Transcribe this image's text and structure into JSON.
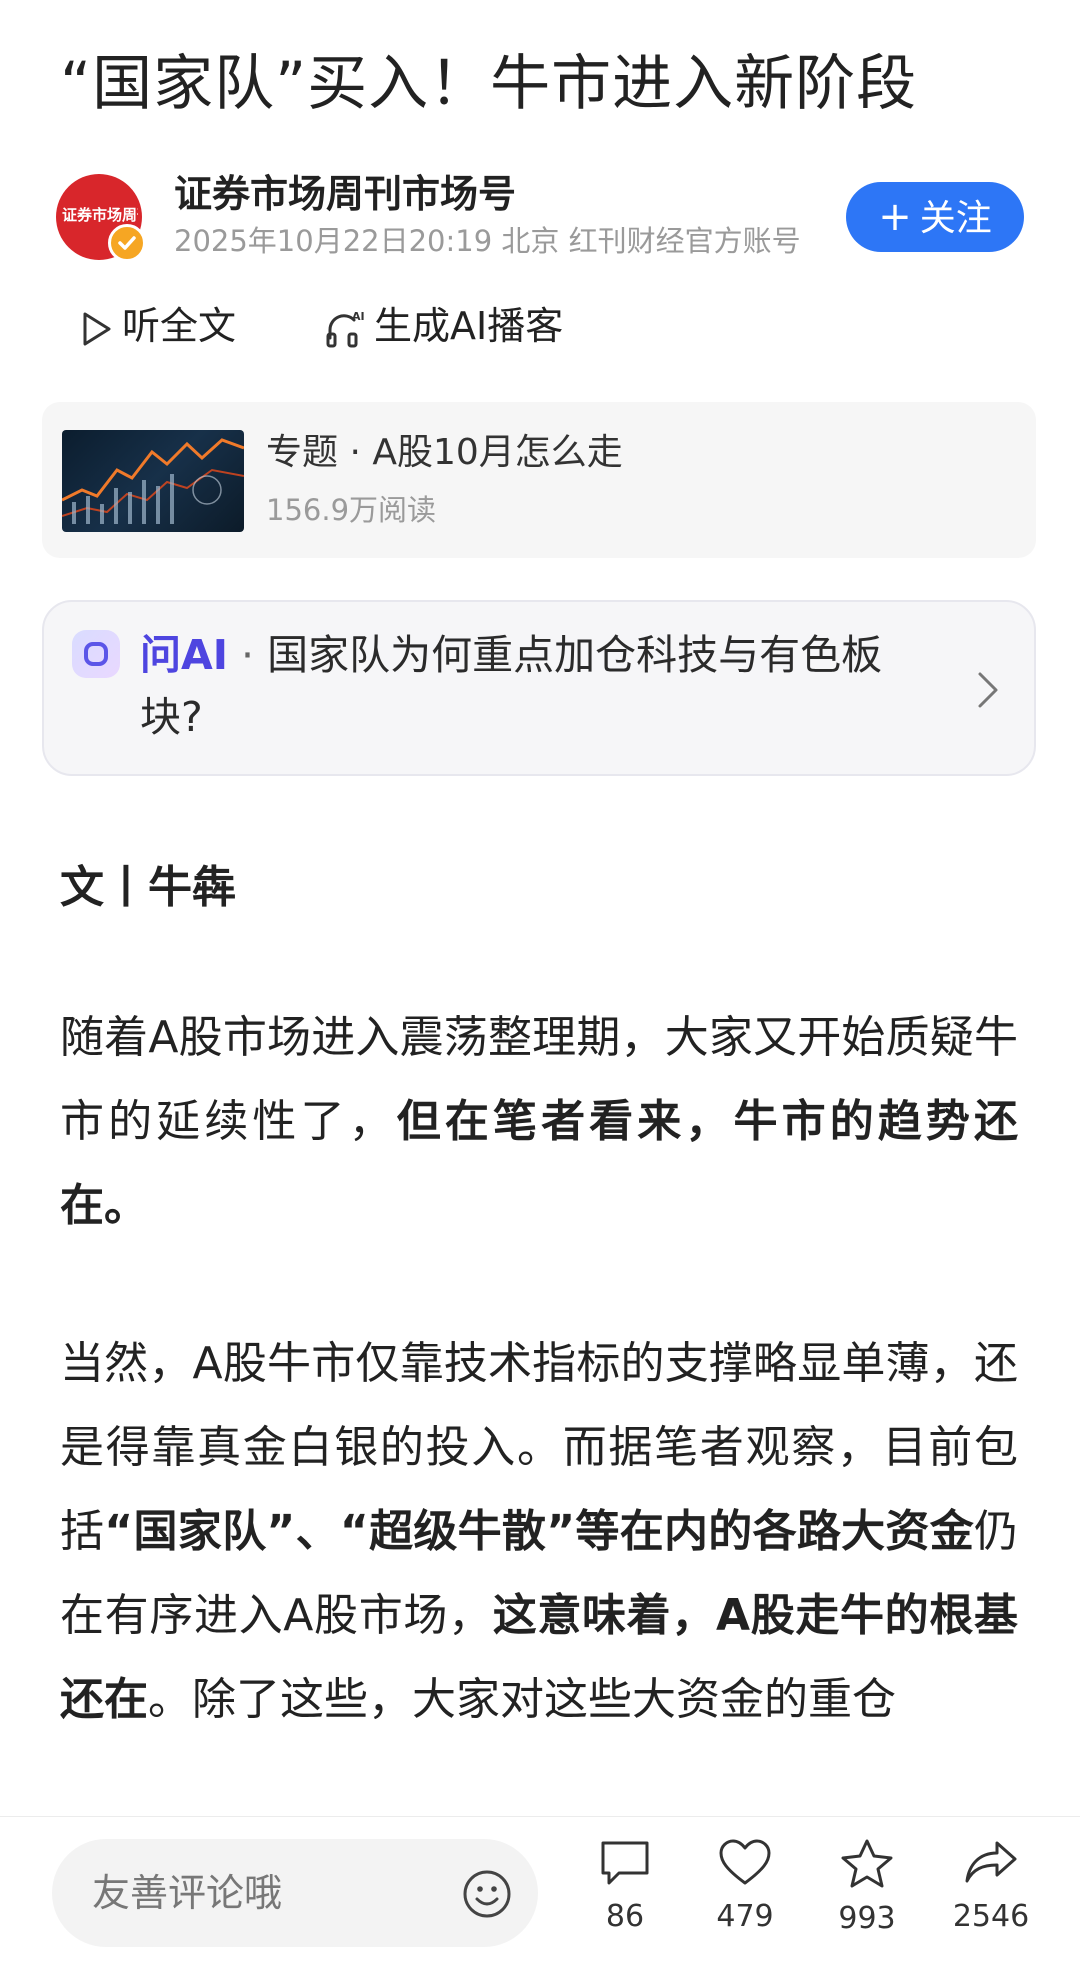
{
  "article": {
    "title": "“国家队”买入！牛市进入新阶段",
    "byline": "文丨牛犇"
  },
  "author": {
    "name": "证券市场周刊市场号",
    "avatar_text": "证券市场周刊",
    "meta": "2025年10月22日20:19 北京 红刊财经官方账号",
    "follow_label": "关注"
  },
  "audio": {
    "listen_label": "听全文",
    "podcast_label": "生成AI播客"
  },
  "topic": {
    "title": "专题 · A股10月怎么走",
    "reads": "156.9万阅读"
  },
  "ask_ai": {
    "label": "问AI",
    "separator": " · ",
    "question": "国家队为何重点加仓科技与有色板块?"
  },
  "paragraph1": {
    "t1": "随着A股市场进入震荡整理期，大家又开始质疑牛市的延续性了，",
    "t2": "但在笔者看来，牛市的趋势还在。"
  },
  "paragraph2": {
    "t1": "当然，A股牛市仅靠技术指标的支撑略显单薄，还是得靠真金白银的投入。而据笔者观察，目前包括",
    "t2": "“国家队”、“超级牛散”等在内的各路大资金",
    "t3": "仍在有序进入A股市场，",
    "t4": "这意味着，A股走牛的根基还在",
    "t5": "。除了这些，大家对这些大资金的重仓"
  },
  "bottom_bar": {
    "comment_placeholder": "友善评论哦",
    "comment_count": "86",
    "like_count": "479",
    "favorite_count": "993",
    "share_count": "2546"
  },
  "colors": {
    "follow_blue": "#2d76f6",
    "ai_purple": "#4e45e0",
    "avatar_red": "#d8262b",
    "verified_orange": "#f6a623"
  }
}
